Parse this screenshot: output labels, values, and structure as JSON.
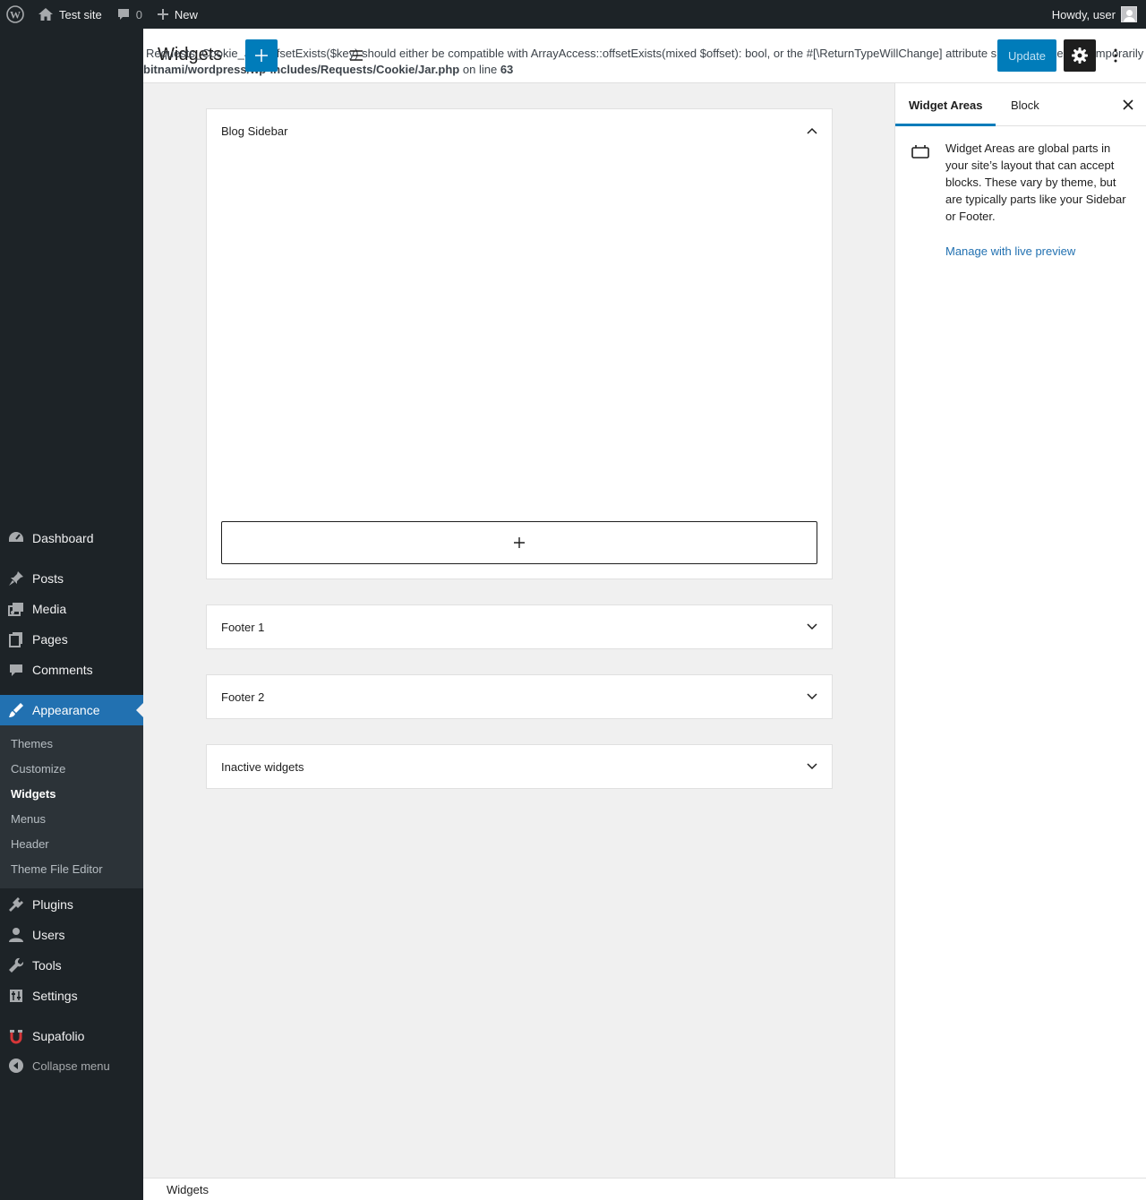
{
  "admin_bar": {
    "site_name": "Test site",
    "comments_count": "0",
    "new_label": "New",
    "howdy": "Howdy, user"
  },
  "sidebar": {
    "items": [
      {
        "label": "Dashboard",
        "icon": "dashboard-icon"
      },
      {
        "label": "Posts",
        "icon": "pin-icon"
      },
      {
        "label": "Media",
        "icon": "media-icon"
      },
      {
        "label": "Pages",
        "icon": "pages-icon"
      },
      {
        "label": "Comments",
        "icon": "comment-icon"
      },
      {
        "label": "Appearance",
        "icon": "brush-icon"
      },
      {
        "label": "Plugins",
        "icon": "plugin-icon"
      },
      {
        "label": "Users",
        "icon": "user-icon"
      },
      {
        "label": "Tools",
        "icon": "wrench-icon"
      },
      {
        "label": "Settings",
        "icon": "settings-icon"
      },
      {
        "label": "Supafolio",
        "icon": "supafolio-icon"
      }
    ],
    "submenu": [
      "Themes",
      "Customize",
      "Widgets",
      "Menus",
      "Header",
      "Theme File Editor"
    ],
    "collapse_label": "Collapse menu"
  },
  "header": {
    "title": "Widgets",
    "notice_line1": "Requests_Cookie_Jar::offsetExists($key) should either be compatible with ArrayAccess::offsetExists(mixed $offset): bool, or the #[\\ReturnTypeWillChange] attribute should be used to temporarily",
    "notice_path": "bitnami/wordpress/wp-includes/Requests/Cookie/Jar.php",
    "notice_on_line": "on line",
    "notice_line_number": "63",
    "update_label": "Update"
  },
  "widget_areas": [
    {
      "title": "Blog Sidebar",
      "expanded": true
    },
    {
      "title": "Footer 1",
      "expanded": false
    },
    {
      "title": "Footer 2",
      "expanded": false
    },
    {
      "title": "Inactive widgets",
      "expanded": false
    }
  ],
  "settings_panel": {
    "tab_widget_areas": "Widget Areas",
    "tab_block": "Block",
    "description": "Widget Areas are global parts in your site’s layout that can accept blocks. These vary by theme, but are typically parts like your Sidebar or Footer.",
    "manage_link": "Manage with live preview"
  },
  "footer": {
    "breadcrumb": "Widgets"
  },
  "colors": {
    "accent": "#007cba",
    "admin_bar": "#1d2327",
    "menu_active": "#2271b1"
  }
}
